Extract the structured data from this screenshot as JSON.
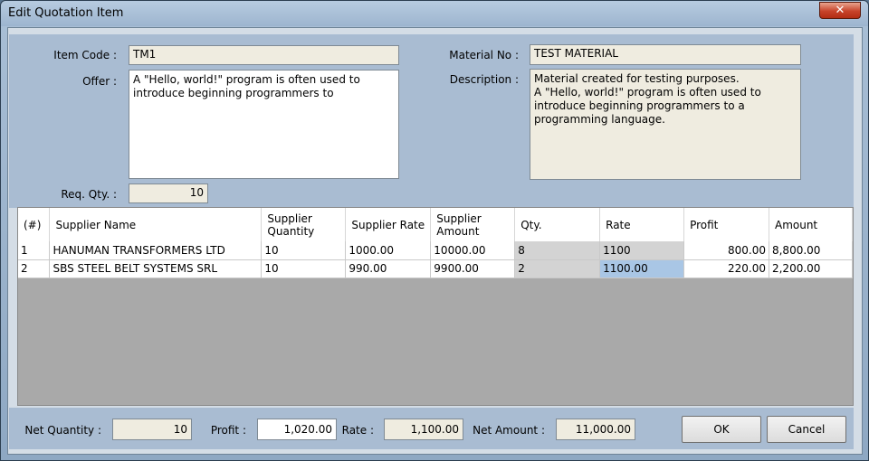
{
  "window": {
    "title": "Edit Quotation Item",
    "close_label": "✕"
  },
  "form": {
    "item_code_label": "Item Code :",
    "item_code_value": "TM1",
    "offer_label": "Offer :",
    "offer_value": "A \"Hello, world!\" program is often used to introduce beginning programmers to",
    "req_qty_label": "Req. Qty. :",
    "req_qty_value": "10",
    "material_no_label": "Material No :",
    "material_no_value": "TEST MATERIAL",
    "description_label": "Description :",
    "description_value": "Material created for testing purposes.\nA \"Hello, world!\" program is often used to introduce beginning programmers to a programming language."
  },
  "grid": {
    "columns": [
      "(#)",
      "Supplier Name",
      "Supplier Quantity",
      "Supplier Rate",
      "Supplier Amount",
      "Qty.",
      "Rate",
      "Profit",
      "Amount"
    ],
    "rows": [
      [
        "1",
        "HANUMAN TRANSFORMERS LTD",
        "10",
        "1000.00",
        "10000.00",
        "8",
        "1100",
        "800.00",
        "8,800.00"
      ],
      [
        "2",
        "SBS STEEL BELT SYSTEMS SRL",
        "10",
        "990.00",
        "9900.00",
        "2",
        "1100.00",
        "220.00",
        "2,200.00"
      ]
    ]
  },
  "footer": {
    "net_qty_label": "Net Quantity :",
    "net_qty_value": "10",
    "profit_label": "Profit :",
    "profit_value": "1,020.00",
    "rate_label": "Rate :",
    "rate_value": "1,100.00",
    "net_amount_label": "Net Amount :",
    "net_amount_value": "11,000.00",
    "ok_label": "OK",
    "cancel_label": "Cancel"
  },
  "icons": {
    "close": "close-icon"
  },
  "colors": {
    "field_bg": "#efece0",
    "panel_bg": "#a9bcd2",
    "grid_bg": "#a9a9a9",
    "selected_cell": "#a9c6e5"
  }
}
